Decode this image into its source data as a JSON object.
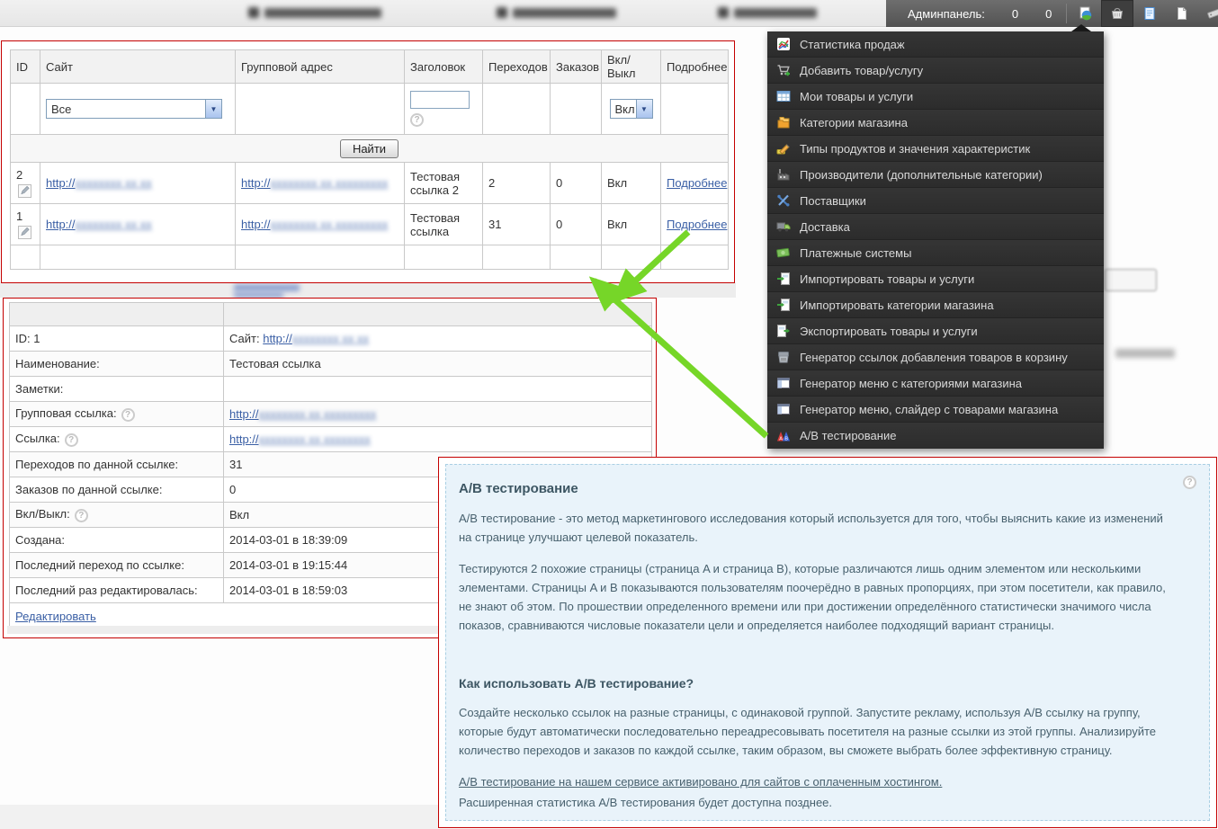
{
  "admin_bar": {
    "label": "Админпанель:",
    "counts": [
      "0",
      "0"
    ],
    "icons": [
      "globe-page",
      "basket",
      "doc-blue",
      "doc-white",
      "tag",
      "server",
      "columns"
    ],
    "active_icon_index": 1
  },
  "menu": {
    "items": [
      {
        "label": "Статистика продаж",
        "icon": "stats"
      },
      {
        "label": "Добавить товар/услугу",
        "icon": "cart-add"
      },
      {
        "label": "Мои товары и услуги",
        "icon": "table"
      },
      {
        "label": "Категории магазина",
        "icon": "folders"
      },
      {
        "label": "Типы продуктов и значения характеристик",
        "icon": "characteristics"
      },
      {
        "label": "Производители (дополнительные категории)",
        "icon": "factory"
      },
      {
        "label": "Поставщики",
        "icon": "suppliers"
      },
      {
        "label": "Доставка",
        "icon": "truck"
      },
      {
        "label": "Платежные системы",
        "icon": "money"
      },
      {
        "label": "Импортировать товары и услуги",
        "icon": "import"
      },
      {
        "label": "Импортировать категории магазина",
        "icon": "import"
      },
      {
        "label": "Экспортировать товары и услуги",
        "icon": "export"
      },
      {
        "label": "Генератор ссылок добавления товаров в корзину",
        "icon": "cart-gen"
      },
      {
        "label": "Генератор меню с категориями магазина",
        "icon": "menu-gen"
      },
      {
        "label": "Генератор меню, слайдер с товарами магазина",
        "icon": "menu-gen"
      },
      {
        "label": "A/B тестирование",
        "icon": "ab"
      }
    ]
  },
  "ui": {
    "help_glyph": "?",
    "select_arrow": "▼",
    "url_prefix": "http://"
  },
  "redacted": {
    "site": "xxxxxxxx xx xx",
    "group": "xxxxxxxx xx xxxxxxxxx",
    "link": "xxxxxxxx xx xxxxxxxx"
  },
  "links_table": {
    "headers": [
      "ID",
      "Сайт",
      "Групповой адрес",
      "Заголовок",
      "Переходов",
      "Заказов",
      "Вкл/Выкл",
      "Подробнее"
    ],
    "filters": {
      "site": "Все",
      "title_value": "",
      "state": "Вкл"
    },
    "search_button": "Найти",
    "rows": [
      {
        "id": "2",
        "title": "Тестовая ссылка 2",
        "transitions": "2",
        "orders": "0",
        "state": "Вкл",
        "details_label": "Подробнее"
      },
      {
        "id": "1",
        "title": "Тестовая ссылка",
        "transitions": "31",
        "orders": "0",
        "state": "Вкл",
        "details_label": "Подробнее"
      }
    ]
  },
  "details_panel": {
    "rows": [
      {
        "label": "ID: 1",
        "help": false,
        "type": "sitelink",
        "prefix": "Сайт: ",
        "blur": "site"
      },
      {
        "label": "Наименование:",
        "help": false,
        "type": "text",
        "value": "Тестовая ссылка"
      },
      {
        "label": "Заметки:",
        "help": false,
        "type": "text",
        "value": ""
      },
      {
        "label": "Групповая ссылка:",
        "help": true,
        "type": "link",
        "blur": "group"
      },
      {
        "label": "Ссылка:",
        "help": true,
        "type": "link",
        "blur": "link"
      },
      {
        "label": "Переходов по данной ссылке:",
        "help": false,
        "type": "text",
        "value": "31"
      },
      {
        "label": "Заказов по данной ссылке:",
        "help": false,
        "type": "text",
        "value": "0"
      },
      {
        "label": "Вкл/Выкл:",
        "help": true,
        "type": "text",
        "value": "Вкл"
      },
      {
        "label": "Создана:",
        "help": false,
        "type": "text",
        "value": "2014-03-01 в 18:39:09"
      },
      {
        "label": "Последний переход по ссылке:",
        "help": false,
        "type": "text",
        "value": "2014-03-01 в 19:15:44"
      },
      {
        "label": "Последний раз редактировалась:",
        "help": false,
        "type": "text",
        "value": "2014-03-01 в 18:59:03"
      }
    ],
    "edit_link": "Редактировать"
  },
  "info_panel": {
    "title": "A/B тестирование",
    "p1": "A/B тестирование - это метод маркетингового исследования который используется для того, чтобы выяснить какие из изменений на странице улучшают целевой показатель.",
    "p2": "Тестируются 2 похожие страницы (страница A и страница B), которые различаются лишь одним элементом или несколькими элементами. Страницы A и B показываются пользователям поочерёдно в равных пропорциях, при этом посетители, как правило, не знают об этом. По прошествии определенного времени или при достижении определённого статистически значимого числа показов, сравниваются числовые показатели цели и определяется наиболее подходящий вариант страницы.",
    "subtitle": "Как использовать A/B тестирование?",
    "p3": "Создайте несколько ссылок на разные страницы, с одинаковой группой. Запустите рекламу, используя A/B ссылку на группу, которые будут автоматически последовательно переадресовывать посетителя на разные ссылки из этой группы. Анализируйте количество переходов и заказов по каждой ссылке, таким образом, вы сможете выбрать более эффективную страницу.",
    "activated_link": "A/B тестирование на нашем сервисе активировано для сайтов с оплаченным хостингом.",
    "footnote": "Расширенная статистика A/B тестирования будет доступна позднее."
  },
  "colors": {
    "accent_red": "#c40000",
    "arrow_green": "#76d628",
    "menu_bg": "#2d2d2d",
    "info_bg": "#e9f3fa",
    "link_blue": "#3a5fa5"
  }
}
